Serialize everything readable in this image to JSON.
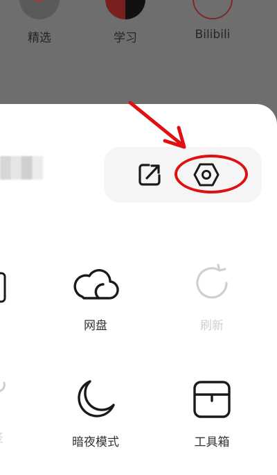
{
  "background_app": {
    "shortcuts": [
      {
        "label": "精选",
        "icon": "featured-avatar-icon"
      },
      {
        "label": "学习",
        "icon": "study-avatar-icon"
      },
      {
        "label": "Bilibili",
        "icon": "bilibili-avatar-icon"
      }
    ]
  },
  "sheet": {
    "actions": [
      {
        "icon": "share-edit-icon"
      },
      {
        "icon": "settings-hexagon-icon"
      }
    ],
    "grid": [
      {
        "label": "网盘",
        "icon": "cloud-drive-icon",
        "enabled": true
      },
      {
        "label": "刷新",
        "icon": "refresh-icon",
        "enabled": false
      },
      {
        "label": "暗夜模式",
        "icon": "dark-mode-moon-icon",
        "enabled": true
      },
      {
        "label": "工具箱",
        "icon": "toolbox-icon",
        "enabled": true
      },
      {
        "label": "签",
        "icon": "partial-left-icon",
        "enabled": false
      }
    ]
  },
  "annotation": {
    "accent_color": "#e01010"
  },
  "colors": {
    "overlay": "#6e6e6e",
    "sheet": "#ffffff",
    "pill": "#f5f5f6",
    "icon": "#1a1a1a",
    "disabled": "#cfcfcf"
  }
}
